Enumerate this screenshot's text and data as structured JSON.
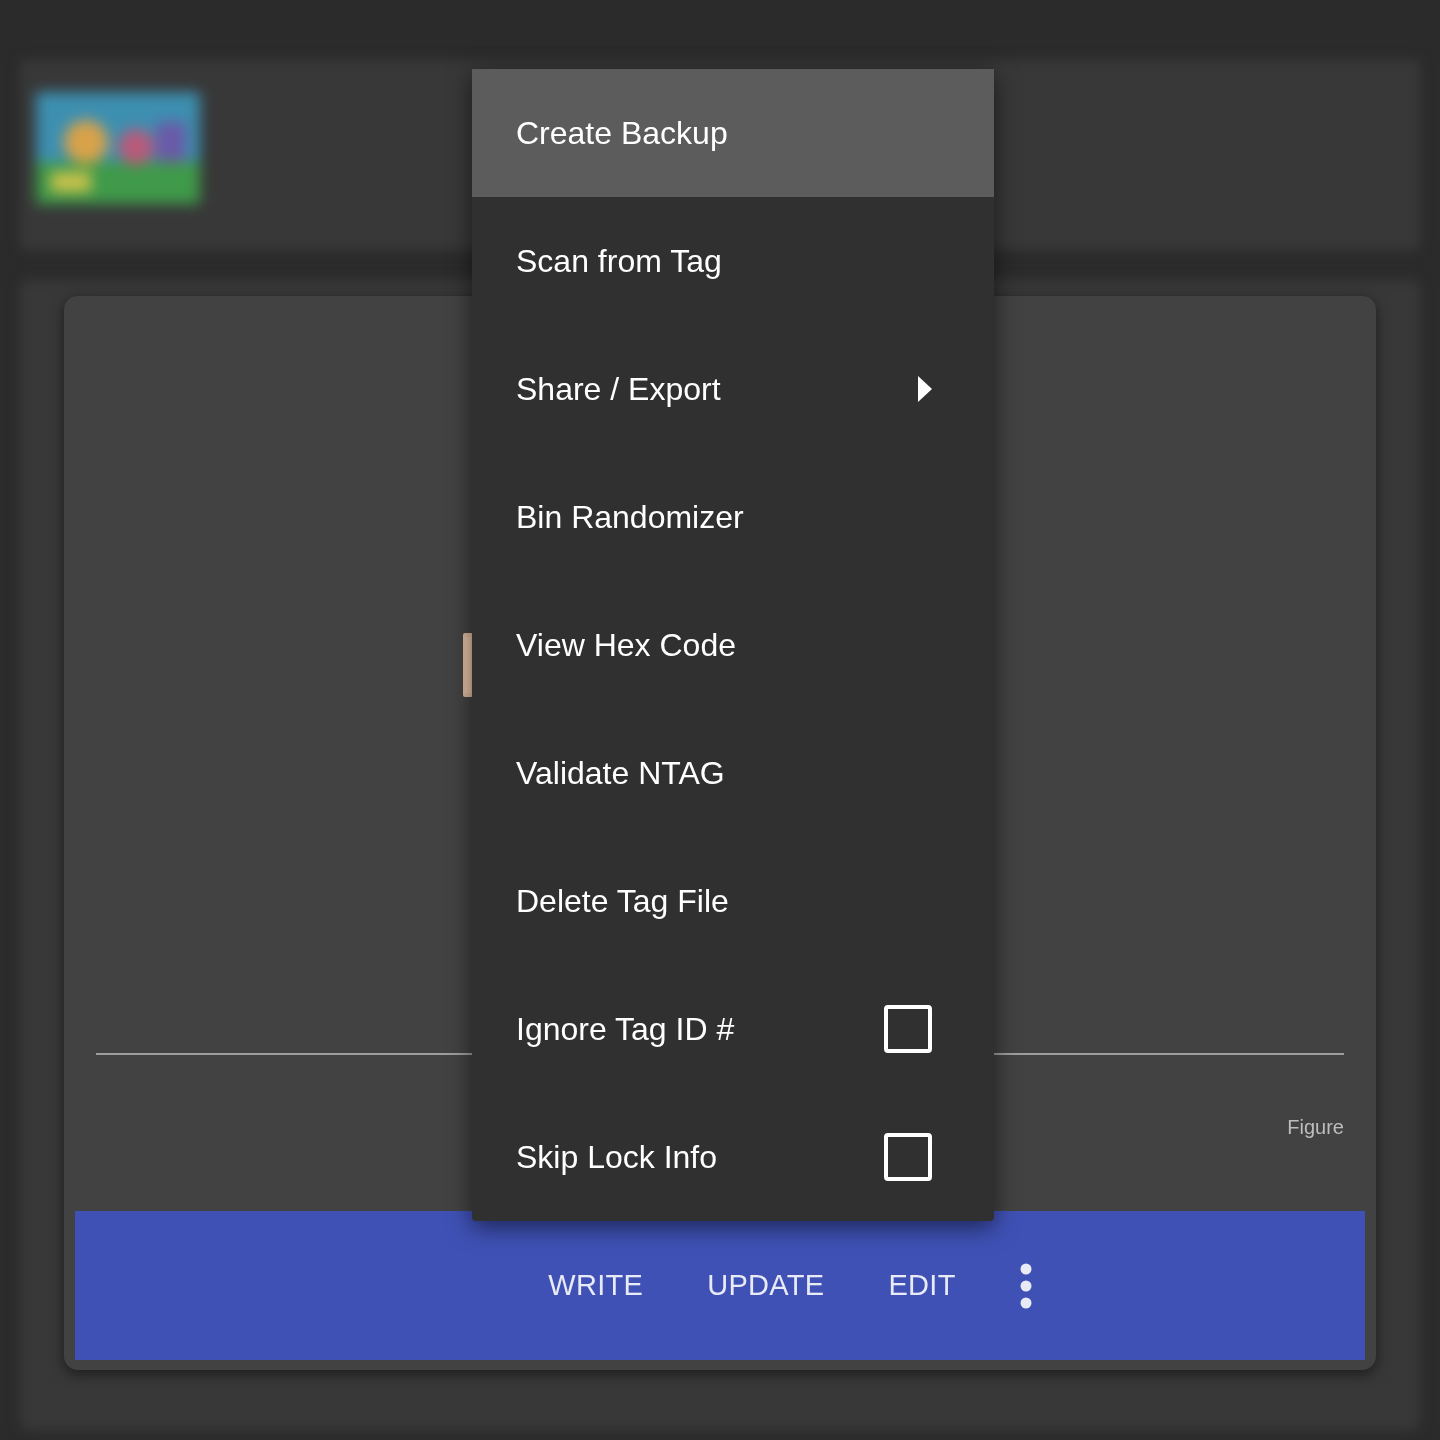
{
  "menu": {
    "items": [
      {
        "label": "Create Backup",
        "kind": "action",
        "selected": true
      },
      {
        "label": "Scan from Tag",
        "kind": "action",
        "selected": false
      },
      {
        "label": "Share / Export",
        "kind": "submenu",
        "selected": false
      },
      {
        "label": "Bin Randomizer",
        "kind": "action",
        "selected": false
      },
      {
        "label": "View Hex Code",
        "kind": "action",
        "selected": false
      },
      {
        "label": "Validate NTAG",
        "kind": "action",
        "selected": false
      },
      {
        "label": "Delete Tag File",
        "kind": "action",
        "selected": false
      },
      {
        "label": "Ignore Tag ID #",
        "kind": "checkbox",
        "selected": false,
        "checked": false
      },
      {
        "label": "Skip Lock Info",
        "kind": "checkbox",
        "selected": false,
        "checked": false
      }
    ]
  },
  "dialog": {
    "field_label": "Figure",
    "actions": [
      "WRITE",
      "UPDATE",
      "EDIT"
    ]
  }
}
